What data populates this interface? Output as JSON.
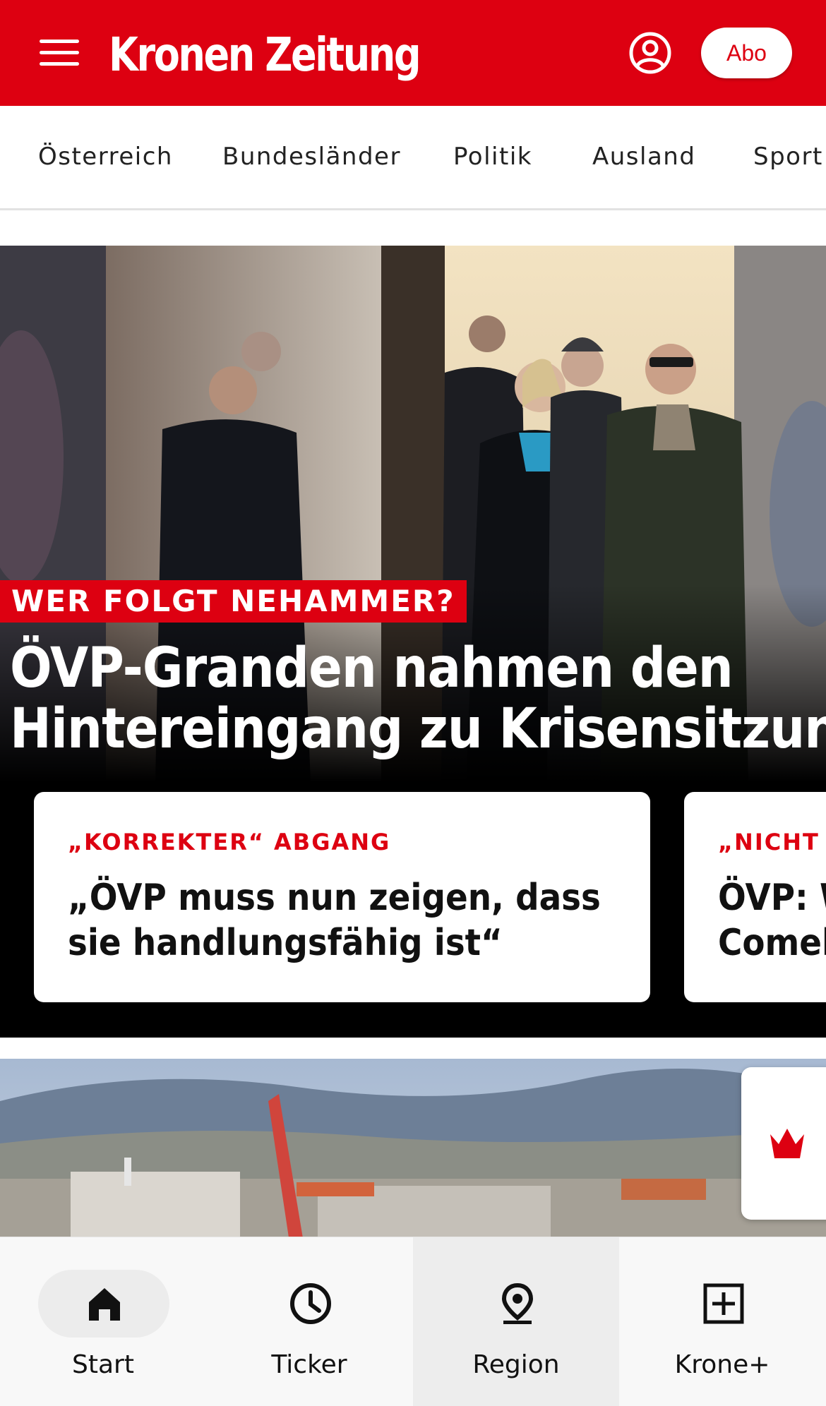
{
  "header": {
    "logo_text": "Kronen Zeitung",
    "abo_label": "Abo",
    "brand_color": "#dd0011",
    "menu_icon": "hamburger-menu-icon",
    "account_icon": "user-account-icon"
  },
  "categories": [
    "Österreich",
    "Bundesländer",
    "Politik",
    "Ausland",
    "Sport"
  ],
  "hero": {
    "kicker": "WER FOLGT NEHAMMER?",
    "headline_line1": "ÖVP-Granden nahmen den",
    "headline_line2": "Hintereingang zu Krisensitzung"
  },
  "related_cards": [
    {
      "kicker": "„KORREKTER“ ABGANG",
      "title_line1": "„ÖVP muss nun zeigen, dass",
      "title_line2": "sie handlungsfähig ist“"
    },
    {
      "kicker": "„NICHT A",
      "title_line1": "ÖVP: W",
      "title_line2": "Comeb"
    }
  ],
  "krone_plus_badge_icon": "krone-crown-icon",
  "bottom_nav": [
    {
      "label": "Start",
      "icon": "home-icon",
      "active": true
    },
    {
      "label": "Ticker",
      "icon": "clock-icon",
      "active": false
    },
    {
      "label": "Region",
      "icon": "location-pin-icon",
      "active": false
    },
    {
      "label": "Krone+",
      "icon": "plus-box-icon",
      "active": false
    }
  ]
}
